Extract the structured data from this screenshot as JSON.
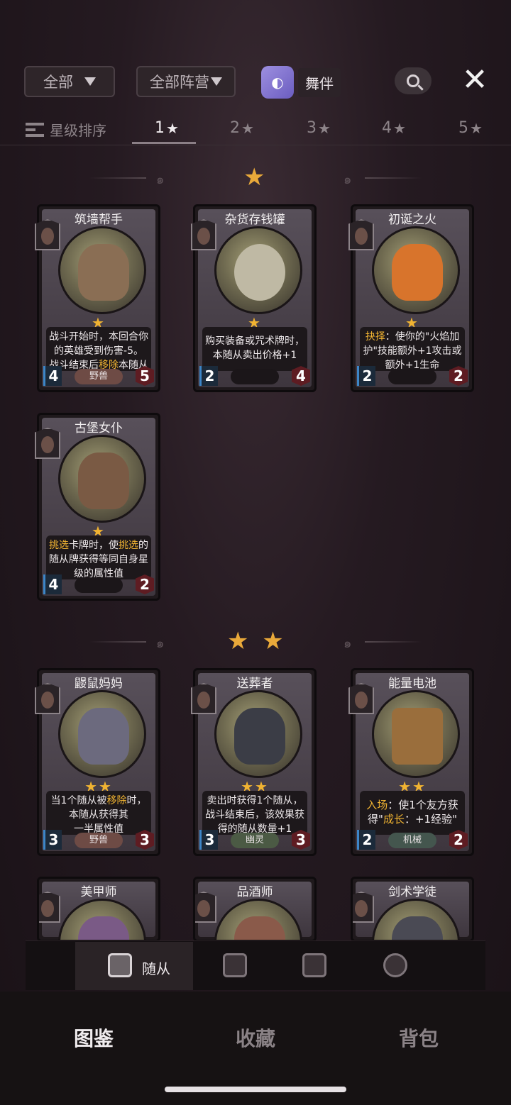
{
  "top": {
    "filter_all": "全部",
    "filter_faction": "全部阵营",
    "companion_label": "舞伴",
    "close_symbol": "✕"
  },
  "star_tabs": {
    "sort_label": "星级排序",
    "tabs": [
      "1",
      "2",
      "3",
      "4",
      "5"
    ],
    "active_index": 0
  },
  "tiers": [
    {
      "stars": "★"
    },
    {
      "stars": "★ ★"
    }
  ],
  "cards": [
    {
      "name": "筑墙帮手",
      "text": [
        "战斗开始时，本回合你",
        "的英雄受到伤害-5。",
        "战斗结束后",
        "移除",
        "本随从"
      ],
      "atk": "4",
      "hp": "5",
      "tribe": "野兽",
      "stars": "★"
    },
    {
      "name": "杂货存钱罐",
      "text": [
        "购买装备或咒术牌时，",
        "本随从卖出价格+1"
      ],
      "atk": "2",
      "hp": "4",
      "tribe": "",
      "stars": "★"
    },
    {
      "name": "初诞之火",
      "text": [
        "抉择",
        "：使你的\"火焰加",
        "护\"技能额外+1攻击或",
        "额外+1生命"
      ],
      "atk": "2",
      "hp": "2",
      "tribe": "",
      "stars": "★"
    },
    {
      "name": "古堡女仆",
      "text": [
        "挑选",
        "卡牌时，使",
        "挑选",
        "的",
        "随从牌获得等同自身星",
        "级的属性值"
      ],
      "atk": "4",
      "hp": "2",
      "tribe": "",
      "stars": "★"
    },
    {
      "name": "鼹鼠妈妈",
      "text": [
        "当1个随从被",
        "移除",
        "时，",
        "本随从获得其",
        "一半属性值"
      ],
      "atk": "3",
      "hp": "3",
      "tribe": "野兽",
      "stars": "★★"
    },
    {
      "name": "送葬者",
      "text": [
        "卖出时获得1个随从，",
        "战斗结束后，该效果获",
        "得的随从数量+1"
      ],
      "atk": "3",
      "hp": "3",
      "tribe": "幽灵",
      "stars": "★★"
    },
    {
      "name": "能量电池",
      "text": [
        "入场",
        "：使1个友方获",
        "得\"",
        "成长",
        "：+1经验\""
      ],
      "atk": "2",
      "hp": "2",
      "tribe": "机械",
      "stars": "★★"
    },
    {
      "name": "美甲师"
    },
    {
      "name": "品酒师"
    },
    {
      "name": "剑术学徒"
    }
  ],
  "subnav": {
    "active_label": "随从"
  },
  "mainnav": [
    "图鉴",
    "收藏",
    "背包"
  ]
}
